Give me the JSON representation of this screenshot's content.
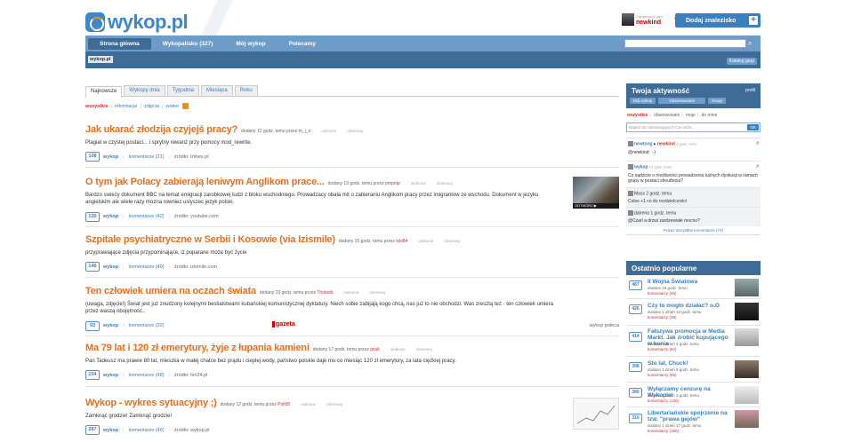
{
  "header": {
    "logo": "wykop.pl",
    "beta": "BETA",
    "user_hint": "Zalogowany jako",
    "user_name": "newkind",
    "add_button": "Dodaj znalezisko",
    "add_plus": "+"
  },
  "nav": {
    "items": [
      "Strona główna",
      "Wykopalisko (327)",
      "Mój wykop",
      "Polecamy"
    ],
    "search_placeholder": ""
  },
  "subbar": {
    "crumb": "wykop.pl",
    "katalog": "Katalog grup"
  },
  "tabs": [
    "Najnowsze",
    "Wykopy dnia",
    "Tygodnia",
    "Miesiąca",
    "Roku"
  ],
  "filters": [
    "wszystkie",
    "informacje",
    "zdjęcia",
    "wideo"
  ],
  "entries": [
    {
      "title": "Jak ukarać złodzija czyjejś pracy?",
      "meta": "dodany 12 godz. temu przez",
      "author": "m_i_n",
      "fav": "ulubione",
      "obs": "obserwuj",
      "desc": "Plagiat w czystej postaci... i sprytny rewanż przy pomocy mod_rewrite.",
      "count": "108",
      "wykop": "wykop",
      "kom": "komentarze (21)",
      "src": "źródło: trlinex.pl"
    },
    {
      "title": "O tym jak Polacy zabierają leniwym Anglikom prace...",
      "meta": "dodany 13 godz. temu przez",
      "author": "pmpmp",
      "fav": "ulubione",
      "obs": "obserwuj",
      "desc": "Bardzo swiezy dokument BBC na temat emigracji zarobkowej ludzi z bloku wschodniego. Prowadzacy obala mit o zabieraniu Anglikom pracy przez imigrantow ze wschodu. Dokument w jezyku angielskim ale wiele razy mozna rowniez uslyszec jezyk polski.",
      "count": "130",
      "wykop": "wykop",
      "kom": "komentarze (42)",
      "src": "źródło: youtube.com",
      "thumb_caption": "ODTWÓRZ ▶"
    },
    {
      "title": "Szpitale psychiatryczne w Serbii i Kosowie (via Izismile)",
      "meta": "dodany 15 godz. temu przez",
      "author": "luki84",
      "fav": "ulubione",
      "obs": "obserwuj",
      "desc": "przyprawiające zdjęcia przypominające, iż poparane może być życie",
      "count": "146",
      "wykop": "wykop",
      "kom": "komentarze (49)",
      "src": "źródło: izismile.com"
    },
    {
      "title": "Ten człowiek umiera na oczach świata",
      "meta": "dodany 23 godz. temu przez",
      "author": "Thobold",
      "fav": "ulubione",
      "obs": "obserwuj",
      "desc": "(uwaga, zdjęcie!) Świat jest już znudzony kolejnymi bestialstwami kubańskiej komunistycznej dyktatury. Niech sobie zabijają kogo chcą, nas już to nie obchodzi. Was zresztą też - ten człowiek umiera przez waszą obojętność..",
      "count": "93",
      "wykop": "wykop",
      "kom": "komentarze (32)",
      "src": "",
      "gazeta": "gazeta",
      "right": "wykop poleca"
    },
    {
      "title": "Ma 79 lat i 120 zł emerytury, żyje z łupania kamieni",
      "meta": "dodany 17 godz. temu przez",
      "author": "gsuk",
      "fav": "ulubione",
      "obs": "obserwuj",
      "desc": "Pan Tadeusz ma prawie 80 lat, mieszka w małej chatce bez prądu i cieplej wody, państwo polskie daje mu co miesiąc 120 zł emerytury, za lata ciężkiej pracy.",
      "count": "154",
      "wykop": "wykop",
      "kom": "komentarze (48)",
      "src": "źródło: tvn24.pl"
    },
    {
      "title": "Wykop - wykres sytuacyjny ;)",
      "meta": "dodany 12 godz. temu przez",
      "author": "Poll68",
      "fav": "ulubione",
      "obs": "obserwuj",
      "desc": "Zamknąć grodzie! Zamknąć grodzie!",
      "count": "287",
      "wykop": "wykop",
      "kom": "komentarze (46)",
      "src": "źródło: wykop.pl"
    }
  ],
  "activity": {
    "title": "Twoja aktywność",
    "profil": "profil",
    "buttons": [
      "Mój wykop",
      "Obserwowane",
      "Grupy"
    ],
    "filters": [
      "wszystkie",
      "obserwowani",
      "moje",
      "do mnie"
    ],
    "input_placeholder": "Napisz do obserwujących Cię osób...",
    "ok": "OK",
    "items": [
      {
        "user": "newtong",
        "to": "newkind",
        "time": "9 godz. temu",
        "text": "@newkind: :-)"
      },
      {
        "user": "wykop",
        "time": "21 godz. temu",
        "text": "Co sądzicie o możliwości prowadzenia luźnych dyskusji w ramach grupy w postaci shoutboxa?"
      }
    ],
    "replies": [
      {
        "user": "Mass",
        "time": "2 godz. temu",
        "text": "Colos +1 co do rozdzielczości"
      },
      {
        "user": "datrena",
        "time": "1 godz. temu",
        "text": "@Czarl a drzwi zardzewiałe mocno?"
      }
    ],
    "show_all": "Pokaż wszystkie komentarze (74)"
  },
  "popular": {
    "title": "Ostatnio popularne",
    "items": [
      {
        "count": "487",
        "title": "II Wojna Światowa",
        "l1": "dodano 19 godz. temu",
        "l2": "komentarzy (48)"
      },
      {
        "count": "426",
        "title": "Czy to mogło działać? o.O",
        "l1": "dodano 1 dzień 13 godz. temu",
        "l2": "komentarzy (39)"
      },
      {
        "count": "414",
        "title": "Fałszywa promocja w Media Markt. Jak zrobić kupującego w konia",
        "l1": "dodano 1 dzień 4 godz. temu",
        "l2": "komentarzy (94)"
      },
      {
        "count": "398",
        "title": "Sto lat, Chuck!",
        "l1": "dodano 1 dzień 6 godz. temu",
        "l2": "komentarzy (85)"
      },
      {
        "count": "380",
        "title": "Wyłączamy cenzurę na Wykopie!",
        "l1": "dodano 1 dzień 3 godz. temu",
        "l2": "komentarzy (130)"
      },
      {
        "count": "310",
        "title": "Libertariańskie spojrzenie na tzw. \"prawa gejów\"",
        "l1": "dodano 1 dzień 17 godz. temu",
        "l2": "komentarzy (190)"
      }
    ]
  }
}
